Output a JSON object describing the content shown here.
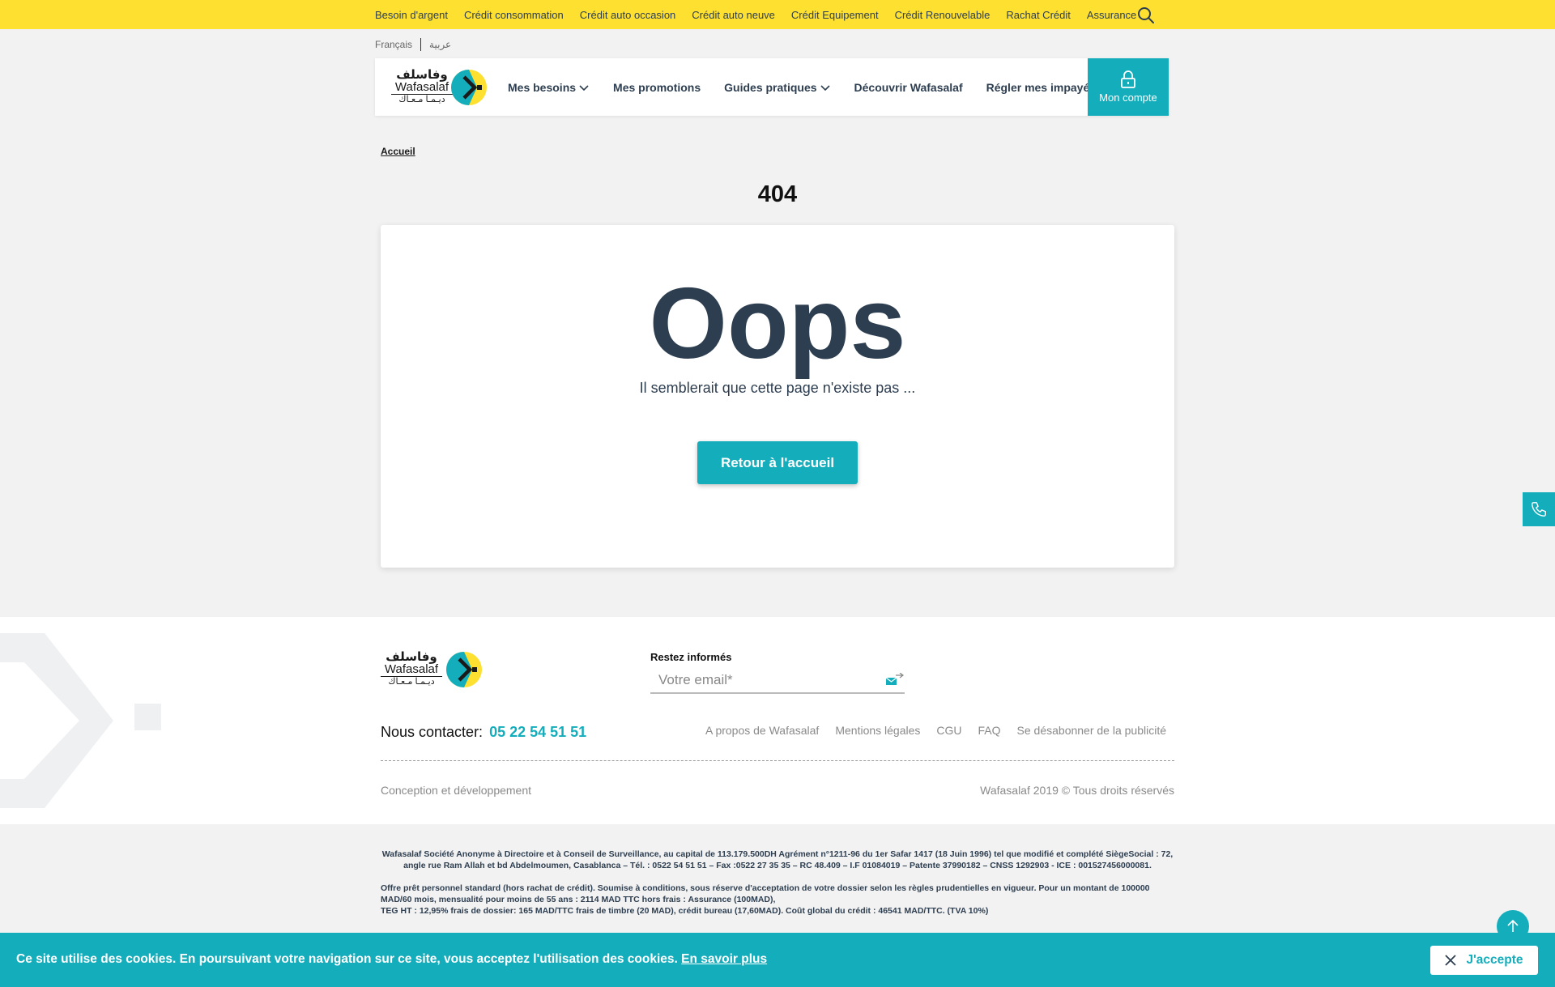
{
  "topbar": {
    "links": [
      "Besoin d'argent",
      "Crédit consommation",
      "Crédit auto occasion",
      "Crédit auto neuve",
      "Crédit Equipement",
      "Crédit Renouvelable",
      "Rachat Crédit",
      "Assurance"
    ],
    "search_icon": "search-icon"
  },
  "languages": {
    "fr": "Français",
    "ar": "عربية"
  },
  "logo": {
    "ar_top": "وفاسلف",
    "latin": "Wafasalaf",
    "ar_bottom": "ديـمـا مـعـاك"
  },
  "nav": {
    "items": [
      "Mes besoins",
      "Mes promotions",
      "Guides pratiques",
      "Découvrir Wafasalaf",
      "Régler mes impayés"
    ],
    "account_label": "Mon compte"
  },
  "breadcrumb": "Accueil",
  "error": {
    "code": "404",
    "title": "Oops",
    "message": "Il semblerait que cette page n'existe pas ...",
    "button": "Retour à l'accueil"
  },
  "footer": {
    "newsletter_title": "Restez informés",
    "newsletter_placeholder": "Votre email*",
    "contact_label": "Nous contacter:",
    "contact_phone": "05 22 54 51 51",
    "links": [
      "A propos de Wafasalaf",
      "Mentions légales",
      "CGU",
      "FAQ",
      "Se désabonner de la publicité"
    ],
    "design": "Conception et développement",
    "copyright": "Wafasalaf 2019 © Tous droits réservés"
  },
  "legal": {
    "company": "Wafasalaf Société Anonyme à Directoire et à Conseil de Surveillance, au capital de 113.179.500DH Agrément n°1211-96 du 1er Safar 1417 (18 Juin 1996) tel que modifié et complété SiègeSocial : 72, angle rue Ram Allah et bd Abdelmoumen, Casablanca – Tél. : 0522 54 51 51 – Fax :0522 27 35 35 – RC 48.409 – I.F 01084019 – Patente 37990182 – CNSS 1292903 - ICE : 001527456000081.",
    "offer_1": "Offre prêt personnel standard (hors rachat de crédit). Soumise à conditions, sous réserve d'acceptation de votre dossier selon les règles prudentielles en vigueur. Pour un montant de 100000 MAD/60 mois, mensualité pour moins de 55 ans : 2114 MAD TTC hors frais : Assurance (100MAD),",
    "offer_2": "TEG HT : 12,95% frais de dossier: 165 MAD/TTC frais de timbre (20 MAD), crédit bureau (17,60MAD). Coût global du crédit : 46541 MAD/TTC. (TVA 10%)"
  },
  "cookie": {
    "text": "Ce site utilise des cookies. En poursuivant votre navigation sur ce site, vous acceptez l'utilisation des cookies.",
    "link": "En savoir plus",
    "accept": "J'accepte"
  },
  "colors": {
    "yellow": "#fee031",
    "teal": "#14adbb",
    "navy": "#2d3e50",
    "background": "#f2f2f2"
  }
}
